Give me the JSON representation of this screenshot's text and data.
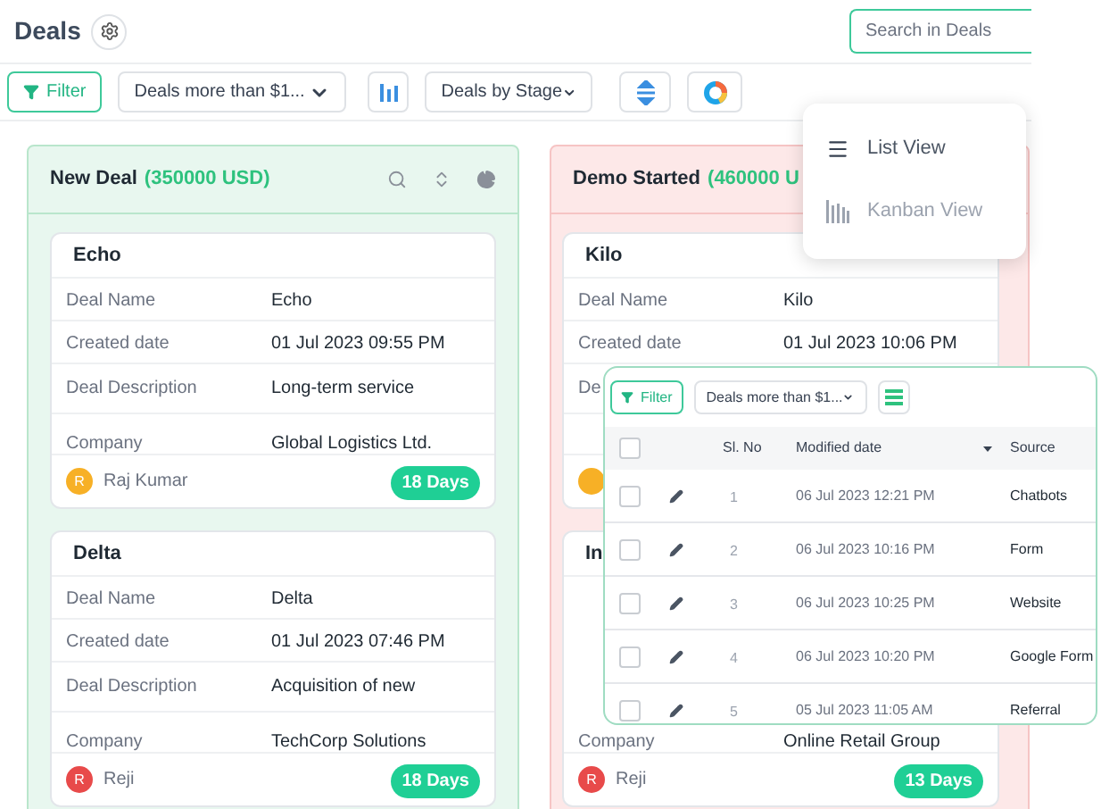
{
  "header": {
    "title": "Deals",
    "search": {
      "placeholder": "Search in Deals"
    }
  },
  "toolbar": {
    "filter": "Filter",
    "deal_filter": "Deals more than $1...",
    "group_by": "Deals by Stage"
  },
  "columns": [
    {
      "title": "New Deal",
      "amount": "(350000 USD)",
      "color": "#e8f7ef",
      "cards": [
        {
          "title": "Echo",
          "fields": [
            {
              "label": "Deal Name",
              "value": "Echo"
            },
            {
              "label": "Created date",
              "value": "01 Jul 2023 09:55 PM"
            },
            {
              "label": "Deal Description",
              "value": "Long-term service"
            }
          ],
          "company": {
            "label": "Company",
            "value": "Global Logistics Ltd."
          },
          "owner": "Raj Kumar",
          "avatar": {
            "initial": "R",
            "color": "#f7b026"
          },
          "age": "18 Days"
        },
        {
          "title": "Delta",
          "fields": [
            {
              "label": "Deal Name",
              "value": "Delta"
            },
            {
              "label": "Created date",
              "value": "01 Jul 2023 07:46 PM"
            },
            {
              "label": "Deal Description",
              "value": "Acquisition of new"
            }
          ],
          "company": {
            "label": "Company",
            "value": "TechCorp Solutions"
          },
          "owner": "Reji",
          "avatar": {
            "initial": "R",
            "color": "#e84a4a"
          },
          "age": "18 Days"
        }
      ]
    },
    {
      "title": "Demo Started",
      "amount": "(460000 U",
      "color": "#fde8e8",
      "cards": [
        {
          "title": "Kilo",
          "fields": [
            {
              "label": "Deal Name",
              "value": "Kilo"
            },
            {
              "label": "Created date",
              "value": "01 Jul 2023 10:06 PM"
            },
            {
              "label": "De"
            }
          ],
          "avatar": {
            "color": "#f7b026"
          }
        },
        {
          "title": "In",
          "company": {
            "label": "Company",
            "value": "Online Retail Group"
          },
          "owner": "Reji",
          "avatar": {
            "initial": "R",
            "color": "#e84a4a"
          },
          "age": "13 Days"
        }
      ]
    }
  ],
  "view_menu": [
    {
      "label": "List View",
      "kind": "list",
      "selected": true
    },
    {
      "label": "Kanban View",
      "kind": "kanban",
      "selected": false
    }
  ],
  "list_preview": {
    "all_checked": false,
    "filter": "Filter",
    "deal_filter": "Deals more than $1...",
    "columns": [
      "Sl. No",
      "Modified date",
      "Source"
    ],
    "rows": [
      {
        "number": "1",
        "modified": "06 Jul 2023 12:21 PM",
        "source": "Chatbots",
        "checked": false
      },
      {
        "number": "2",
        "modified": "06 Jul 2023 10:16 PM",
        "source": "Form",
        "checked": false
      },
      {
        "number": "3",
        "modified": "06 Jul 2023 10:25 PM",
        "source": "Website",
        "checked": false
      },
      {
        "number": "4",
        "modified": "06 Jul 2023 10:20 PM",
        "source": "Google Form",
        "checked": false
      },
      {
        "number": "5",
        "modified": "05 Jul 2023 11:05 AM",
        "source": "Referral",
        "checked": false
      }
    ]
  }
}
